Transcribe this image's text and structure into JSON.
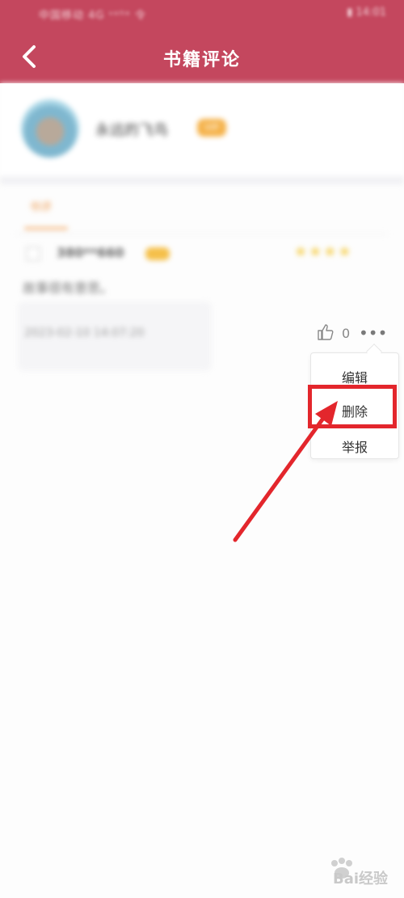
{
  "status_bar": {
    "left": "中国移动 4G ᵛᵒˡᵗᵉ 令",
    "right": "▮ 14:01"
  },
  "header": {
    "title": "书籍评论"
  },
  "profile": {
    "username": "永远的飞鸟",
    "badge": "VIP"
  },
  "tabs": [
    {
      "label": "书评"
    }
  ],
  "review": {
    "reviewer": "380**660",
    "stars": "★★★★",
    "text": "故事很有意思。",
    "time": "2023-02-10 14:07:20",
    "likes": "0"
  },
  "menu": {
    "edit": "编辑",
    "delete": "删除",
    "report": "举报"
  },
  "watermark": {
    "brand": "Bai",
    "text": "经验"
  },
  "colors": {
    "header": "#c4475e",
    "highlight": "#e3262c",
    "accent": "#f0a25a"
  }
}
